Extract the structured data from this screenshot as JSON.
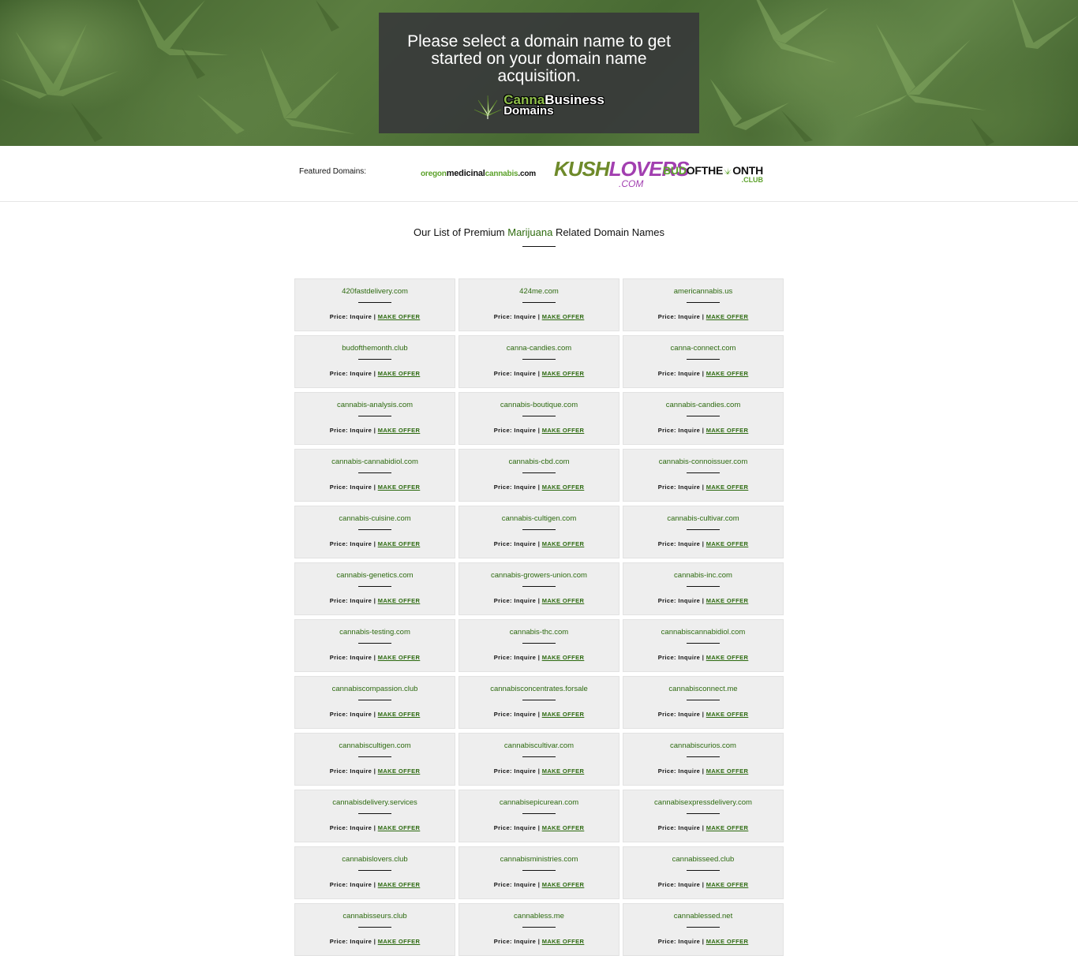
{
  "hero": {
    "headline": "Please select a domain name to get started on your domain name acquisition.",
    "logo_line1_a": "Canna",
    "logo_line1_b": "Business",
    "logo_line2": "Domains"
  },
  "featured": {
    "label": "Featured Domains:",
    "logos": {
      "oregon": {
        "part1": "oregon",
        "part2": "medicinal",
        "part3": "cannabis",
        "part4": ".com"
      },
      "kush": {
        "part1": "KUSH",
        "part2": "LOVERS",
        "part3": ".COM"
      },
      "bud": {
        "part1": "BUD",
        "part2": "OFTHE",
        "part3": "ONTH",
        "part4": ".CLUB"
      }
    }
  },
  "section": {
    "title_before": "Our List of Premium ",
    "title_highlight": "Marijuana",
    "title_after": " Related Domain Names"
  },
  "card_labels": {
    "price_prefix": "Price: Inquire | ",
    "offer": "MAKE OFFER"
  },
  "domains": [
    "420fastdelivery.com",
    "424me.com",
    "americannabis.us",
    "budofthemonth.club",
    "canna-candies.com",
    "canna-connect.com",
    "cannabis-analysis.com",
    "cannabis-boutique.com",
    "cannabis-candies.com",
    "cannabis-cannabidiol.com",
    "cannabis-cbd.com",
    "cannabis-connoissuer.com",
    "cannabis-cuisine.com",
    "cannabis-cultigen.com",
    "cannabis-cultivar.com",
    "cannabis-genetics.com",
    "cannabis-growers-union.com",
    "cannabis-inc.com",
    "cannabis-testing.com",
    "cannabis-thc.com",
    "cannabiscannabidiol.com",
    "cannabiscompassion.club",
    "cannabisconcentrates.forsale",
    "cannabisconnect.me",
    "cannabiscultigen.com",
    "cannabiscultivar.com",
    "cannabiscurios.com",
    "cannabisdelivery.services",
    "cannabisepicurean.com",
    "cannabisexpressdelivery.com",
    "cannabislovers.club",
    "cannabisministries.com",
    "cannabisseed.club",
    "cannabisseurs.club",
    "cannabless.me",
    "cannablessed.net"
  ],
  "colors": {
    "accent_green": "#2d6a10",
    "card_bg": "#eeeeee",
    "hero_box": "#37373a"
  }
}
